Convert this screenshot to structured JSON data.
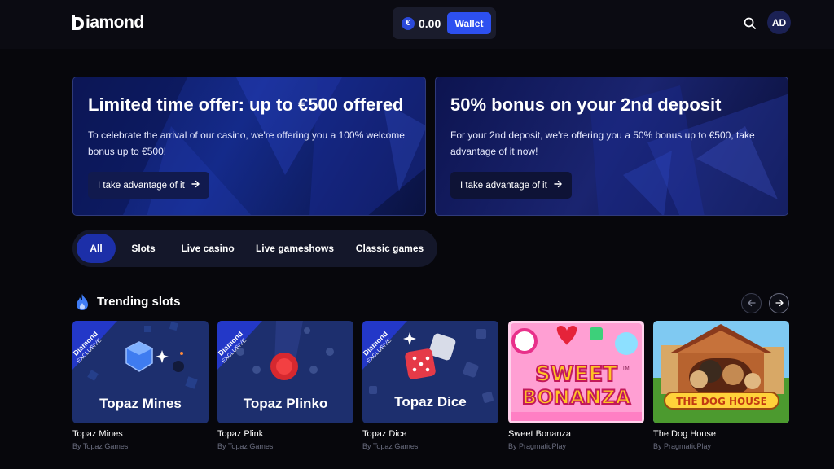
{
  "header": {
    "logo_text": "iamond",
    "balance": "0.00",
    "currency_symbol": "€",
    "wallet_label": "Wallet",
    "avatar_initials": "AD"
  },
  "promos": [
    {
      "title": "Limited time offer: up to €500 offered",
      "description": "To celebrate the arrival of our casino, we're offering you a 100% welcome bonus up to €500!",
      "button_label": "I take advantage of it"
    },
    {
      "title": "50% bonus on your 2nd deposit",
      "description": "For your 2nd deposit, we're offering you a 50% bonus up to €500, take advantage of it now!",
      "button_label": "I take advantage of it"
    }
  ],
  "tabs": [
    {
      "label": "All",
      "active": true
    },
    {
      "label": "Slots",
      "active": false
    },
    {
      "label": "Live casino",
      "active": false
    },
    {
      "label": "Live gameshows",
      "active": false
    },
    {
      "label": "Classic games",
      "active": false
    }
  ],
  "trending": {
    "title": "Trending slots",
    "games": [
      {
        "name": "Topaz Mines",
        "provider": "By Topaz Games",
        "art_title": "Topaz Mines",
        "ribbon_brand": "Diamond",
        "ribbon_tag": "EXCLUSIVE"
      },
      {
        "name": "Topaz Plink",
        "provider": "By Topaz Games",
        "art_title": "Topaz Plinko",
        "ribbon_brand": "Diamond",
        "ribbon_tag": "EXCLUSIVE"
      },
      {
        "name": "Topaz Dice",
        "provider": "By Topaz Games",
        "art_title": "Topaz Dice",
        "ribbon_brand": "Diamond",
        "ribbon_tag": "EXCLUSIVE"
      },
      {
        "name": "Sweet Bonanza",
        "provider": "By PragmaticPlay",
        "art_title_top": "SWEET",
        "art_title_bottom": "BONANZA",
        "art_tm": "TM"
      },
      {
        "name": "The Dog House",
        "provider": "By PragmaticPlay",
        "art_title": "THE DOG HOUSE"
      }
    ]
  },
  "colors": {
    "background": "#07070c",
    "accent": "#2d50f0",
    "tab_active": "#1c2fa8",
    "text_muted": "#6b6e80"
  },
  "icons": {
    "search": "search-icon",
    "euro": "euro-icon",
    "arrow_right": "arrow-right-icon",
    "arrow_left": "arrow-left-icon",
    "flame": "flame-icon"
  }
}
